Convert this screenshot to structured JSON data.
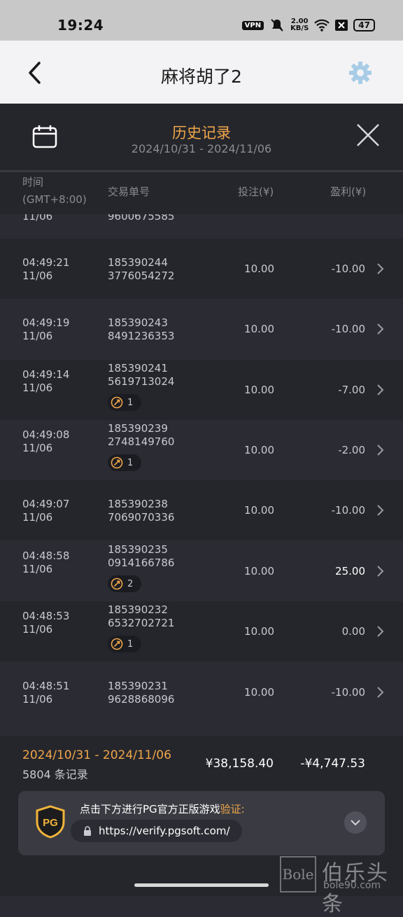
{
  "status_bar": {
    "time": "19:24",
    "vpn": "VPN",
    "speed_value": "2.00",
    "speed_unit": "KB/S",
    "battery": "47"
  },
  "app_bar": {
    "title": "麻将胡了2"
  },
  "history": {
    "title": "历史记录",
    "range": "2024/10/31 - 2024/11/06"
  },
  "columns": {
    "time": "时间",
    "tz": "(GMT+8:00)",
    "order": "交易单号",
    "bet": "投注(¥)",
    "profit": "盈利(¥)"
  },
  "rows": [
    {
      "time": "",
      "date": "11/06",
      "order1": "",
      "order2": "9600675585",
      "bet": "",
      "profit": "",
      "badge": ""
    },
    {
      "time": "04:49:21",
      "date": "11/06",
      "order1": "185390244",
      "order2": "3776054272",
      "bet": "10.00",
      "profit": "-10.00",
      "badge": ""
    },
    {
      "time": "04:49:19",
      "date": "11/06",
      "order1": "185390243",
      "order2": "8491236353",
      "bet": "10.00",
      "profit": "-10.00",
      "badge": ""
    },
    {
      "time": "04:49:14",
      "date": "11/06",
      "order1": "185390241",
      "order2": "5619713024",
      "bet": "10.00",
      "profit": "-7.00",
      "badge": "1"
    },
    {
      "time": "04:49:08",
      "date": "11/06",
      "order1": "185390239",
      "order2": "2748149760",
      "bet": "10.00",
      "profit": "-2.00",
      "badge": "1"
    },
    {
      "time": "04:49:07",
      "date": "11/06",
      "order1": "185390238",
      "order2": "7069070336",
      "bet": "10.00",
      "profit": "-10.00",
      "badge": ""
    },
    {
      "time": "04:48:58",
      "date": "11/06",
      "order1": "185390235",
      "order2": "0914166786",
      "bet": "10.00",
      "profit": "25.00",
      "badge": "2"
    },
    {
      "time": "04:48:53",
      "date": "11/06",
      "order1": "185390232",
      "order2": "6532702721",
      "bet": "10.00",
      "profit": "0.00",
      "badge": "1"
    },
    {
      "time": "04:48:51",
      "date": "11/06",
      "order1": "185390231",
      "order2": "9628868096",
      "bet": "10.00",
      "profit": "-10.00",
      "badge": ""
    }
  ],
  "footer": {
    "range": "2024/10/31 - 2024/11/06",
    "count": "5804 条记录",
    "total_bet": "¥38,158.40",
    "total_profit": "-¥4,747.53"
  },
  "banner": {
    "logo": "PG",
    "text": "点击下方进行PG官方正版游戏",
    "verify": "验证:",
    "url": "https://verify.pgsoft.com/"
  },
  "watermark": {
    "box": "Bole",
    "name": "伯乐头条",
    "url": "bole90.com"
  },
  "colors": {
    "accent": "#f0a64a",
    "bg": "#2b2c33",
    "bg_alt": "#25262c"
  }
}
